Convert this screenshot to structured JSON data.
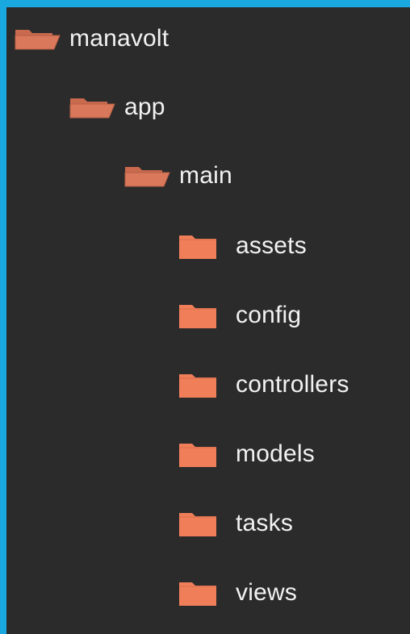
{
  "tree": {
    "root": {
      "label": "manavolt",
      "icon": "folder-open-icon",
      "color": "#d9785b"
    },
    "app": {
      "label": "app",
      "icon": "folder-open-icon",
      "color": "#d9785b"
    },
    "main": {
      "label": "main",
      "icon": "folder-open-icon",
      "color": "#d9785b"
    },
    "children": [
      {
        "label": "assets",
        "icon": "folder-closed-icon",
        "color": "#f07f59"
      },
      {
        "label": "config",
        "icon": "folder-closed-icon",
        "color": "#f07f59"
      },
      {
        "label": "controllers",
        "icon": "folder-closed-icon",
        "color": "#f07f59"
      },
      {
        "label": "models",
        "icon": "folder-closed-icon",
        "color": "#f07f59"
      },
      {
        "label": "tasks",
        "icon": "folder-closed-icon",
        "color": "#f07f59"
      },
      {
        "label": "views",
        "icon": "folder-closed-icon",
        "color": "#f07f59"
      }
    ]
  }
}
